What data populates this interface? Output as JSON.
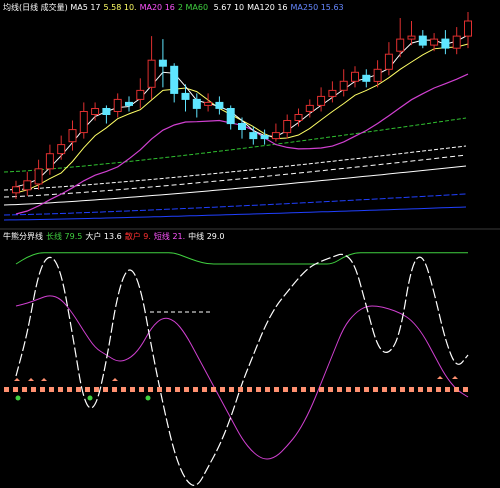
{
  "colors": {
    "background": "#000000",
    "up_candle": "#e03030",
    "down_candle": "#5fe6ff",
    "white_line": "#ffffff",
    "yellow_line": "#ffff66",
    "magenta_line": "#d040d0",
    "green_line": "#30c030",
    "blue_line": "#2040ff",
    "oscillator_white": "#ffffff",
    "oscillator_magenta": "#d040d0",
    "oscillator_green": "#40d040",
    "salmon_marker": "#ff9070"
  },
  "top_legend": [
    {
      "text": "均线(日线 成交量) MA5 17",
      "color": "#ffffff"
    },
    {
      "text": "5.58 10.",
      "color": "#ffff66"
    },
    {
      "text": "MA20 16",
      "color": "#ff55ff"
    },
    {
      "text": "2 MA60 ",
      "color": "#40d040"
    },
    {
      "text": "5.67 10",
      "color": "#ffffff"
    },
    {
      "text": "MA120 16",
      "color": "#ffffff"
    },
    {
      "text": "MA250 15.63",
      "color": "#6688ff"
    }
  ],
  "bottom_legend": [
    {
      "text": "牛熊分界线",
      "color": "#ffffff"
    },
    {
      "text": "长线 79.5",
      "color": "#40d040"
    },
    {
      "text": "大户 13.6",
      "color": "#ffffff"
    },
    {
      "text": "散户 9.",
      "color": "#ff3030"
    },
    {
      "text": "短线 21.",
      "color": "#ff55ff"
    },
    {
      "text": "中线 29.0",
      "color": "#ffffff"
    }
  ],
  "chart_data": [
    {
      "type": "candlestick",
      "candles": [
        {
          "open": 15.2,
          "close": 15.4,
          "high": 15.6,
          "low": 15.0,
          "direction": "up"
        },
        {
          "open": 15.3,
          "close": 15.6,
          "high": 15.9,
          "low": 15.1,
          "direction": "up"
        },
        {
          "open": 15.5,
          "close": 16.0,
          "high": 16.3,
          "low": 15.3,
          "direction": "up"
        },
        {
          "open": 16.0,
          "close": 16.5,
          "high": 16.8,
          "low": 15.8,
          "direction": "up"
        },
        {
          "open": 16.5,
          "close": 16.8,
          "high": 17.1,
          "low": 16.3,
          "direction": "up"
        },
        {
          "open": 16.9,
          "close": 17.3,
          "high": 17.6,
          "low": 16.6,
          "direction": "up"
        },
        {
          "open": 17.2,
          "close": 17.9,
          "high": 18.2,
          "low": 17.0,
          "direction": "up"
        },
        {
          "open": 17.8,
          "close": 18.0,
          "high": 18.2,
          "low": 17.6,
          "direction": "up"
        },
        {
          "open": 18.0,
          "close": 17.8,
          "high": 18.1,
          "low": 17.5,
          "direction": "down"
        },
        {
          "open": 17.9,
          "close": 18.3,
          "high": 18.5,
          "low": 17.7,
          "direction": "up"
        },
        {
          "open": 18.2,
          "close": 18.1,
          "high": 18.4,
          "low": 17.9,
          "direction": "down"
        },
        {
          "open": 18.3,
          "close": 18.6,
          "high": 19.0,
          "low": 18.0,
          "direction": "up"
        },
        {
          "open": 18.7,
          "close": 19.6,
          "high": 20.4,
          "low": 18.3,
          "direction": "up"
        },
        {
          "open": 19.6,
          "close": 19.4,
          "high": 20.3,
          "low": 18.7,
          "direction": "up"
        },
        {
          "open": 19.4,
          "close": 18.5,
          "high": 19.5,
          "low": 18.2,
          "direction": "down"
        },
        {
          "open": 18.5,
          "close": 18.3,
          "high": 18.8,
          "low": 17.9,
          "direction": "down"
        },
        {
          "open": 18.3,
          "close": 18.0,
          "high": 18.5,
          "low": 17.7,
          "direction": "down"
        },
        {
          "open": 18.1,
          "close": 18.2,
          "high": 18.5,
          "low": 17.9,
          "direction": "up"
        },
        {
          "open": 18.2,
          "close": 18.0,
          "high": 18.4,
          "low": 17.8,
          "direction": "down"
        },
        {
          "open": 18.0,
          "close": 17.5,
          "high": 18.1,
          "low": 17.3,
          "direction": "down"
        },
        {
          "open": 17.5,
          "close": 17.3,
          "high": 17.7,
          "low": 17.0,
          "direction": "down"
        },
        {
          "open": 17.2,
          "close": 17.0,
          "high": 17.4,
          "low": 16.8,
          "direction": "down"
        },
        {
          "open": 17.1,
          "close": 17.0,
          "high": 17.3,
          "low": 16.8,
          "direction": "up"
        },
        {
          "open": 17.0,
          "close": 17.2,
          "high": 17.5,
          "low": 16.9,
          "direction": "up"
        },
        {
          "open": 17.2,
          "close": 17.6,
          "high": 17.8,
          "low": 17.0,
          "direction": "up"
        },
        {
          "open": 17.6,
          "close": 17.8,
          "high": 18.0,
          "low": 17.4,
          "direction": "up"
        },
        {
          "open": 17.9,
          "close": 18.1,
          "high": 18.3,
          "low": 17.7,
          "direction": "up"
        },
        {
          "open": 18.1,
          "close": 18.4,
          "high": 18.7,
          "low": 17.9,
          "direction": "up"
        },
        {
          "open": 18.4,
          "close": 18.6,
          "high": 18.9,
          "low": 18.2,
          "direction": "up"
        },
        {
          "open": 18.6,
          "close": 18.9,
          "high": 19.3,
          "low": 18.4,
          "direction": "up"
        },
        {
          "open": 18.9,
          "close": 19.2,
          "high": 19.4,
          "low": 18.7,
          "direction": "up"
        },
        {
          "open": 19.1,
          "close": 18.9,
          "high": 19.3,
          "low": 18.7,
          "direction": "down"
        },
        {
          "open": 18.9,
          "close": 19.3,
          "high": 19.6,
          "low": 18.7,
          "direction": "up"
        },
        {
          "open": 19.3,
          "close": 19.8,
          "high": 20.2,
          "low": 19.1,
          "direction": "up"
        },
        {
          "open": 19.9,
          "close": 20.3,
          "high": 21.0,
          "low": 19.7,
          "direction": "up"
        },
        {
          "open": 20.3,
          "close": 20.4,
          "high": 20.9,
          "low": 20.1,
          "direction": "up"
        },
        {
          "open": 20.4,
          "close": 20.1,
          "high": 20.6,
          "low": 20.0,
          "direction": "down"
        },
        {
          "open": 20.1,
          "close": 20.3,
          "high": 20.5,
          "low": 19.9,
          "direction": "up"
        },
        {
          "open": 20.3,
          "close": 20.0,
          "high": 20.6,
          "low": 19.8,
          "direction": "down"
        },
        {
          "open": 20.0,
          "close": 20.4,
          "high": 20.7,
          "low": 19.8,
          "direction": "up"
        },
        {
          "open": 20.4,
          "close": 20.9,
          "high": 21.2,
          "low": 20.0,
          "direction": "up"
        }
      ]
    },
    {
      "type": "line",
      "series": [
        {
          "name": "长线",
          "color": "#40d040",
          "values": [
            90,
            95,
            98,
            98,
            98,
            98,
            98,
            98,
            98,
            98,
            98,
            98,
            98,
            98,
            98,
            95,
            92,
            90,
            90,
            90,
            90,
            90,
            90,
            90,
            90,
            90,
            90,
            90,
            90,
            95,
            98,
            98,
            98,
            98,
            98,
            98,
            98,
            98,
            98,
            98,
            98
          ]
        },
        {
          "name": "短线",
          "color": "#d040d0",
          "values": [
            60,
            62,
            65,
            68,
            65,
            55,
            42,
            30,
            25,
            20,
            22,
            30,
            45,
            52,
            50,
            40,
            25,
            10,
            -5,
            -20,
            -35,
            -45,
            -50,
            -48,
            -40,
            -30,
            -15,
            5,
            25,
            45,
            55,
            60,
            60,
            58,
            55,
            50,
            40,
            25,
            10,
            0,
            -5
          ]
        },
        {
          "name": "中线",
          "color": "#ffffff",
          "values": [
            10,
            40,
            85,
            98,
            85,
            40,
            -10,
            -15,
            20,
            70,
            90,
            75,
            30,
            -10,
            -45,
            -65,
            -70,
            -55,
            -40,
            -20,
            5,
            25,
            45,
            60,
            70,
            80,
            88,
            92,
            95,
            98,
            90,
            60,
            30,
            25,
            40,
            90,
            98,
            70,
            35,
            15,
            25
          ]
        }
      ],
      "ylim": [
        -70,
        100
      ]
    }
  ]
}
